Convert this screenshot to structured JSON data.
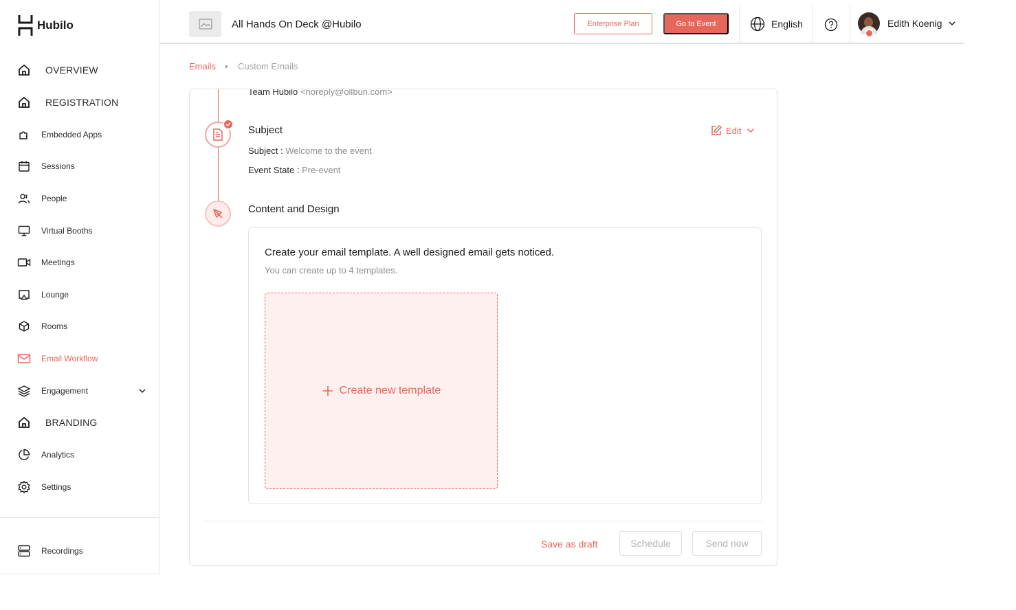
{
  "app": {
    "name": "Hubilo"
  },
  "sidebar": {
    "items": [
      {
        "label": "OVERVIEW",
        "icon": "home-icon"
      },
      {
        "label": "REGISTRATION",
        "icon": "home-icon"
      },
      {
        "label": "Embedded Apps",
        "icon": "puzzle-icon"
      },
      {
        "label": "Sessions",
        "icon": "calendar-icon"
      },
      {
        "label": "People",
        "icon": "people-icon"
      },
      {
        "label": "Virtual Booths",
        "icon": "monitor-icon"
      },
      {
        "label": "Meetings",
        "icon": "video-icon"
      },
      {
        "label": "Lounge",
        "icon": "cast-icon"
      },
      {
        "label": "Rooms",
        "icon": "cube-icon"
      },
      {
        "label": "Email Workflow",
        "icon": "mail-icon"
      },
      {
        "label": "Engagement",
        "icon": "layers-icon"
      },
      {
        "label": "BRANDING",
        "icon": "home-icon"
      },
      {
        "label": "Analytics",
        "icon": "pie-chart-icon"
      },
      {
        "label": "Settings",
        "icon": "gear-icon"
      },
      {
        "label": "Recordings",
        "icon": "server-icon"
      }
    ],
    "active": "Email Workflow"
  },
  "header": {
    "event_title": "All Hands On Deck @Hubilo",
    "enterprise_label": "Enterprise Plan",
    "go_to_event_label": "Go to Event",
    "language": "English",
    "user_name": "Edith Koenig"
  },
  "breadcrumb": {
    "parent": "Emails",
    "current": "Custom Emails"
  },
  "email": {
    "sender_name": "Team Hubilo",
    "sender_address": "<noreply@ollbun.com>",
    "subject_section": {
      "title": "Subject",
      "subject_label": "Subject :",
      "subject_value": "Welcome to the event",
      "state_label": "Event State :",
      "state_value": "Pre-event",
      "edit_label": "Edit"
    },
    "content_section": {
      "title": "Content and Design",
      "heading": "Create your email template. A well designed email gets noticed.",
      "subheading": "You can create up to 4 templates.",
      "create_label": "Create new template"
    }
  },
  "footer": {
    "save_draft_label": "Save as draft",
    "schedule_label": "Schedule",
    "send_now_label": "Send now"
  },
  "colors": {
    "accent": "#e8675b",
    "accent_light": "#fdf0ef",
    "muted_text": "#8d8d8d"
  }
}
